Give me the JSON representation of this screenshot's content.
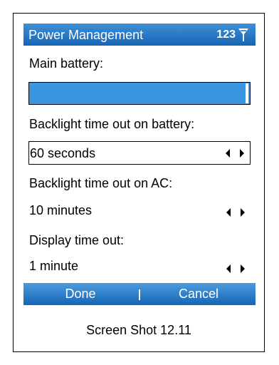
{
  "window": {
    "title": "Power Management",
    "status_number": "123",
    "status_icon": "signal-antenna-icon"
  },
  "fields": {
    "main_battery_label": "Main battery:",
    "backlight_battery_label": "Backlight time out on battery:",
    "backlight_battery_value": "60 seconds",
    "backlight_ac_label": "Backlight time out on AC:",
    "backlight_ac_value": "10 minutes",
    "display_timeout_label": "Display time out:",
    "display_timeout_value": "1 minute"
  },
  "softkeys": {
    "left": "Done",
    "right": "Cancel"
  },
  "caption": "Screen Shot 12.11",
  "colors": {
    "titlebar": "#1e73c4",
    "battery_fill": "#3b96e1",
    "softkey_bar": "#2a7fcd"
  }
}
